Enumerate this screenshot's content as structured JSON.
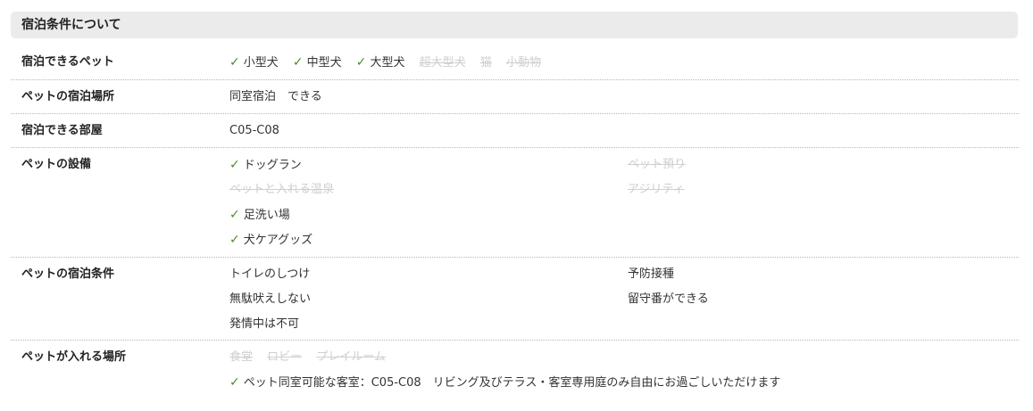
{
  "section": {
    "title": "宿泊条件について"
  },
  "colors": {
    "check": "#4e8c2a",
    "disabled": "#cfcfcf",
    "header_bg": "#ebebeb"
  },
  "rows": [
    {
      "label": "宿泊できるペット",
      "items": [
        {
          "text": "小型犬",
          "enabled": true,
          "icon": "check-icon"
        },
        {
          "text": "中型犬",
          "enabled": true,
          "icon": "check-icon"
        },
        {
          "text": "大型犬",
          "enabled": true,
          "icon": "check-icon"
        },
        {
          "text": "超大型犬",
          "enabled": false
        },
        {
          "text": "猫",
          "enabled": false
        },
        {
          "text": "小動物",
          "enabled": false
        }
      ]
    },
    {
      "label": "ペットの宿泊場所",
      "value": "同室宿泊　できる"
    },
    {
      "label": "宿泊できる部屋",
      "value": "C05-C08"
    },
    {
      "label": "ペットの設備",
      "left": [
        {
          "text": "ドッグラン",
          "enabled": true,
          "icon": "check-icon"
        },
        {
          "text": "ペットと入れる温泉",
          "enabled": false
        },
        {
          "text": "足洗い場",
          "enabled": true,
          "icon": "check-icon"
        },
        {
          "text": "犬ケアグッズ",
          "enabled": true,
          "icon": "check-icon"
        }
      ],
      "right": [
        {
          "text": "ペット預り",
          "enabled": false
        },
        {
          "text": "アジリティ",
          "enabled": false
        }
      ]
    },
    {
      "label": "ペットの宿泊条件",
      "left": [
        "トイレのしつけ",
        "無駄吠えしない",
        "発情中は不可"
      ],
      "right": [
        "予防接種",
        "留守番ができる"
      ]
    },
    {
      "label": "ペットが入れる場所",
      "items": [
        {
          "text": "食堂",
          "enabled": false
        },
        {
          "text": "ロビー",
          "enabled": false
        },
        {
          "text": "プレイルーム",
          "enabled": false
        }
      ],
      "note": {
        "text": "ペット同室可能な客室：C05-C08　リビング及びテラス・客室専用庭のみ自由にお過ごしいただけます",
        "icon": "check-icon"
      }
    }
  ]
}
